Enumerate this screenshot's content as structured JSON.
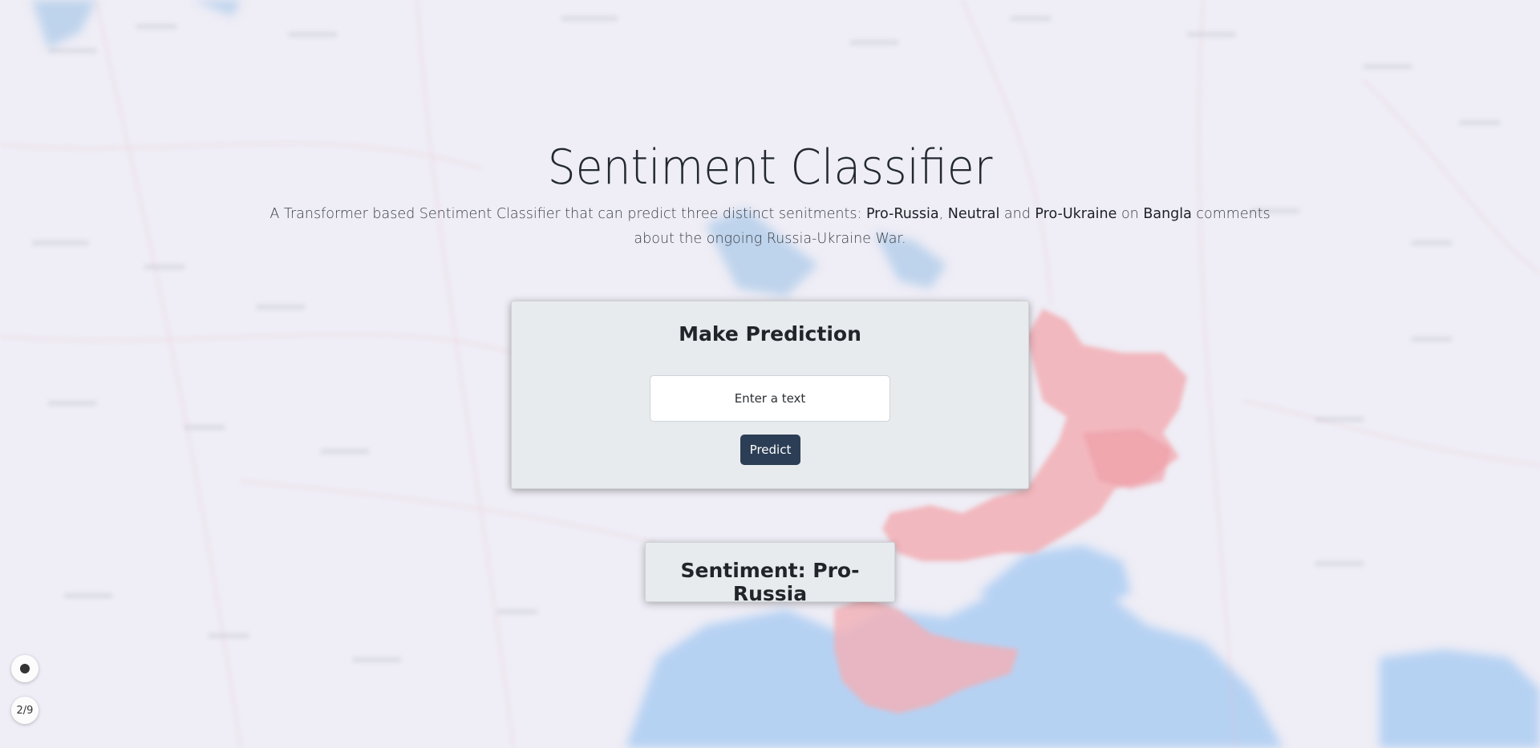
{
  "header": {
    "title": "Sentiment Classifier",
    "subtitle": {
      "part1": "A Transformer based Sentiment Classifier that can predict three distinct senitments: ",
      "pro_russia": "Pro-Russia",
      "sep1": ", ",
      "neutral": "Neutral",
      "sep2": " and ",
      "pro_ukraine": "Pro-Ukraine",
      "sep3": " on ",
      "bangla": "Bangla",
      "part2": " comments about the ongoing Russia-Ukraine War."
    }
  },
  "prediction_form": {
    "title": "Make Prediction",
    "input_placeholder": "Enter a text",
    "input_value": "",
    "predict_label": "Predict"
  },
  "result": {
    "text": "Sentiment: Pro-Russia"
  },
  "map_controls": {
    "locate_icon": "locate-icon",
    "zoom_label": "2/9"
  },
  "colors": {
    "button_bg": "#2c3e55",
    "card_bg": "#e8ebed",
    "occupied_region": "#f2a0a6",
    "sea": "#a9cbf2"
  }
}
